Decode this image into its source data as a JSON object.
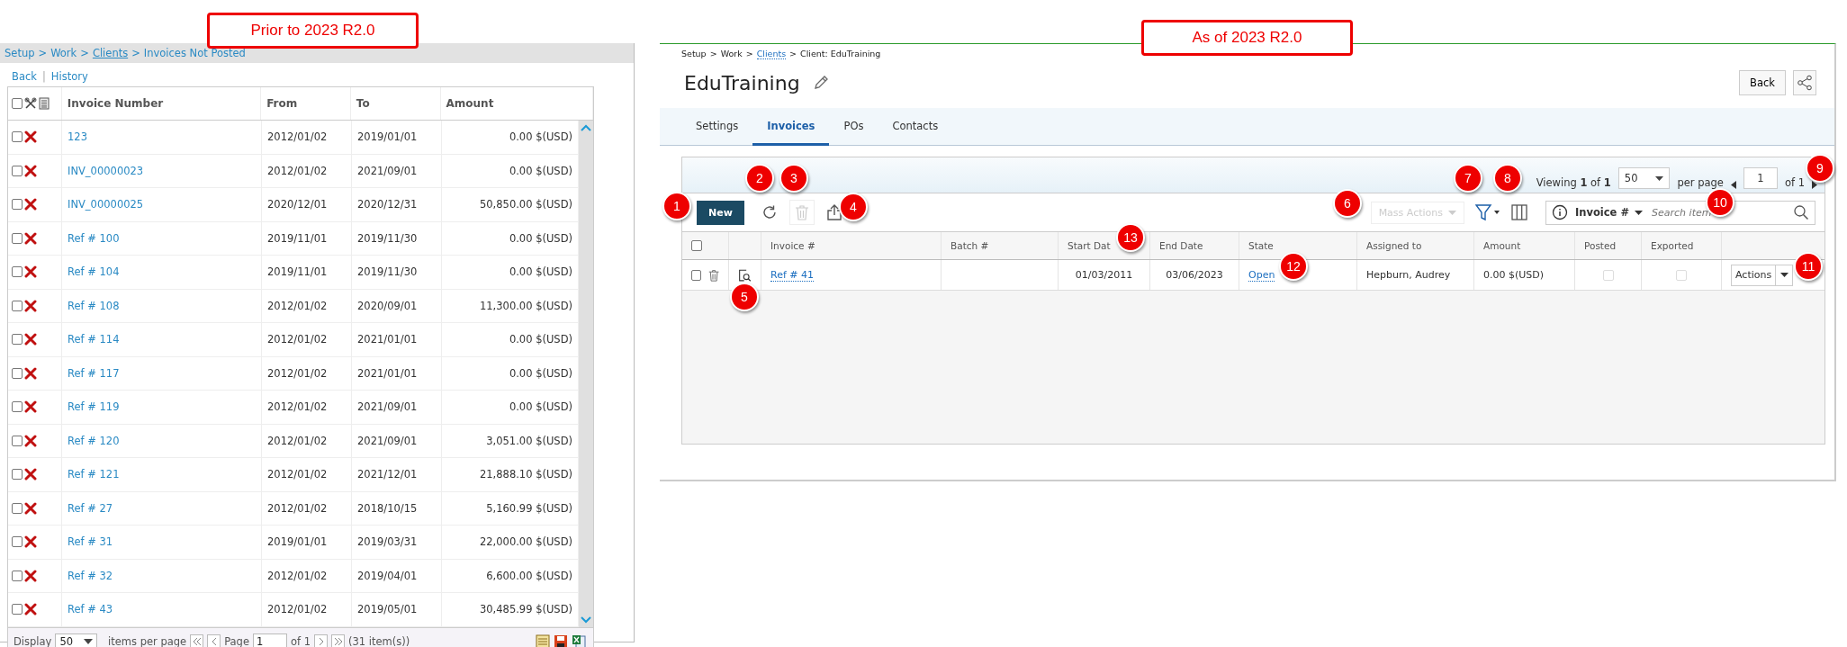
{
  "annotations": [
    {
      "label": "Prior to 2023 R2.0"
    },
    {
      "label": "As of 2023 R2.0"
    }
  ],
  "legacy_view": {
    "breadcrumb": [
      {
        "text": "Setup",
        "link": false
      },
      {
        "text": "Work",
        "link": false
      },
      {
        "text": "Clients",
        "link": true
      },
      {
        "text": "Invoices Not Posted",
        "link": false
      }
    ],
    "separator": ">",
    "links": [
      "Back",
      "History"
    ],
    "link_separator": "|",
    "columns": [
      "Invoice Number",
      "From",
      "To",
      "Amount"
    ],
    "select_all_checked": false,
    "rows": [
      {
        "invoice": "123",
        "from": "2012/01/02",
        "to": "2019/01/01",
        "amount": "0.00 $(USD)",
        "checked": false
      },
      {
        "invoice": "INV_00000023",
        "from": "2012/01/02",
        "to": "2021/09/01",
        "amount": "0.00 $(USD)",
        "checked": false
      },
      {
        "invoice": "INV_00000025",
        "from": "2020/12/01",
        "to": "2020/12/31",
        "amount": "50,850.00 $(USD)",
        "checked": false
      },
      {
        "invoice": "Ref # 100",
        "from": "2019/11/01",
        "to": "2019/11/30",
        "amount": "0.00 $(USD)",
        "checked": false
      },
      {
        "invoice": "Ref # 104",
        "from": "2019/11/01",
        "to": "2019/11/30",
        "amount": "0.00 $(USD)",
        "checked": false
      },
      {
        "invoice": "Ref # 108",
        "from": "2012/01/02",
        "to": "2020/09/01",
        "amount": "11,300.00 $(USD)",
        "checked": false
      },
      {
        "invoice": "Ref # 114",
        "from": "2012/01/02",
        "to": "2021/01/01",
        "amount": "0.00 $(USD)",
        "checked": false
      },
      {
        "invoice": "Ref # 117",
        "from": "2012/01/02",
        "to": "2021/01/01",
        "amount": "0.00 $(USD)",
        "checked": false
      },
      {
        "invoice": "Ref # 119",
        "from": "2012/01/02",
        "to": "2021/09/01",
        "amount": "0.00 $(USD)",
        "checked": false
      },
      {
        "invoice": "Ref # 120",
        "from": "2012/01/02",
        "to": "2021/09/01",
        "amount": "3,051.00 $(USD)",
        "checked": false
      },
      {
        "invoice": "Ref # 121",
        "from": "2012/01/02",
        "to": "2021/12/01",
        "amount": "21,888.10 $(USD)",
        "checked": false
      },
      {
        "invoice": "Ref # 27",
        "from": "2012/01/02",
        "to": "2018/10/15",
        "amount": "5,160.99 $(USD)",
        "checked": false
      },
      {
        "invoice": "Ref # 31",
        "from": "2019/01/01",
        "to": "2019/03/31",
        "amount": "22,000.00 $(USD)",
        "checked": false
      },
      {
        "invoice": "Ref # 32",
        "from": "2012/01/02",
        "to": "2019/04/01",
        "amount": "6,600.00 $(USD)",
        "checked": false
      },
      {
        "invoice": "Ref # 43",
        "from": "2012/01/02",
        "to": "2019/05/01",
        "amount": "30,485.99 $(USD)",
        "checked": false
      }
    ],
    "footer": {
      "display_label": "Display",
      "per_page": "50",
      "items_per_page": "items per page",
      "page_label": "Page",
      "page": "1",
      "of": "of 1",
      "count": "(31 item(s))"
    }
  },
  "new_view": {
    "breadcrumb": [
      {
        "text": "Setup",
        "link": false
      },
      {
        "text": "Work",
        "link": false
      },
      {
        "text": "Clients",
        "link": true
      },
      {
        "text": "Client: EduTraining",
        "link": false
      }
    ],
    "separator": ">",
    "title": "EduTraining",
    "back_button": "Back",
    "tabs": [
      {
        "label": "Settings",
        "selected": false
      },
      {
        "label": "Invoices",
        "selected": true
      },
      {
        "label": "POs",
        "selected": false
      },
      {
        "label": "Contacts",
        "selected": false
      }
    ],
    "pager": {
      "viewing": "Viewing **1** of **1**",
      "per_page": "50",
      "per_page_label": "per page",
      "page": "1",
      "of": "of 1"
    },
    "toolbar": {
      "new_button": "New",
      "delete_disabled": true,
      "mass_actions": "Mass Actions",
      "mass_actions_disabled": true
    },
    "search": {
      "field": "Invoice #",
      "placeholder": "Search item"
    },
    "select_all_checked": false,
    "columns": [
      "Invoice #",
      "Batch #",
      "Start Dat",
      "End Date",
      "State",
      "Assigned to",
      "Amount",
      "Posted",
      "Exported"
    ],
    "rows": [
      {
        "invoice": "Ref # 41",
        "start": "01/03/2011",
        "end": "03/06/2023",
        "state": "Open",
        "assigned": "Hepburn, Audrey",
        "amount": "0.00 $(USD)",
        "posted": false,
        "exported": false,
        "checked": false,
        "action": "Actions"
      }
    ]
  },
  "callouts": [
    "1",
    "2",
    "3",
    "4",
    "5",
    "6",
    "7",
    "8",
    "9",
    "10",
    "11",
    "12",
    "13"
  ]
}
